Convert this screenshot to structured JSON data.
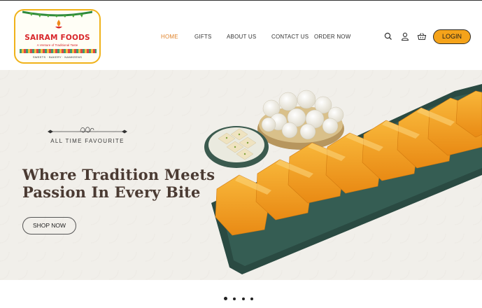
{
  "logo": {
    "brand": "SAIRAM FOODS",
    "tagline": "A Venture of Traditional Taste",
    "sub": "SWEETS · BAKERY · NAMKEENS"
  },
  "nav": {
    "items": [
      "HOME",
      "GIFTS",
      "ABOUT US",
      "CONTACT US",
      "ORDER NOW"
    ],
    "active": "HOME"
  },
  "header_icons": [
    "search-icon",
    "user-icon",
    "basket-icon"
  ],
  "login_label": "LOGIN",
  "hero": {
    "eyebrow": "ALL TIME FAVOURITE",
    "headline_line1": "Where Tradition Meets",
    "headline_line2": "Passion In Every Bite",
    "cta": "SHOP NOW"
  },
  "carousel": {
    "slides": 4,
    "active": 1
  },
  "colors": {
    "accent": "#f5a31a",
    "nav_active": "#e0832a",
    "brand_red": "#d8262a",
    "plate": "#2f5249",
    "sweet": "#f3a52a"
  }
}
